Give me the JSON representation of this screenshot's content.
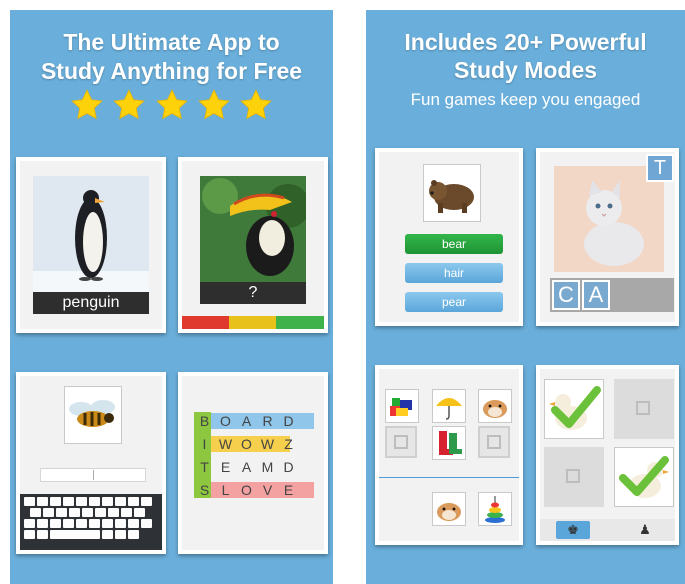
{
  "left_panel": {
    "headline_line1": "The Ultimate App to",
    "headline_line2": "Study Anything for Free",
    "stars": [
      "star-icon",
      "star-icon",
      "star-icon",
      "star-icon",
      "star-icon"
    ],
    "flashcard": {
      "word": "penguin",
      "image": "penguin-icon"
    },
    "guess_card": {
      "prompt": "?",
      "image": "hornbill-icon",
      "meter_colors": [
        "#e03a2f",
        "#e8c11a",
        "#3fb34a"
      ]
    },
    "typing_card": {
      "image": "bee-icon",
      "keyboard": "keyboard-icon"
    },
    "word_search": {
      "rows": [
        [
          "B",
          "O",
          "A",
          "R",
          "D"
        ],
        [
          "I",
          "W",
          "O",
          "W",
          "Z"
        ],
        [
          "T",
          "E",
          "A",
          "M",
          "D"
        ],
        [
          "S",
          "L",
          "O",
          "V",
          "E"
        ]
      ]
    }
  },
  "right_panel": {
    "headline_line1": "Includes 20+ Powerful",
    "headline_line2": "Study Modes",
    "subtitle": "Fun games keep you engaged",
    "multiple_choice": {
      "image": "bear-icon",
      "options": [
        "bear",
        "hair",
        "pear"
      ]
    },
    "spelling": {
      "image": "cat-icon",
      "hint_letter": "T",
      "letters": [
        "C",
        "A"
      ]
    },
    "matching": {
      "items": [
        "toy-icon",
        "umbrella-icon",
        "hamster-icon",
        "boots-icon",
        "hamster-icon",
        "stacking-toy-icon"
      ]
    },
    "memory": {
      "items": [
        "duck-check-icon",
        "duck-check-icon"
      ],
      "tab_icons": [
        "chess-king-icon",
        "chess-pawn-icon"
      ]
    }
  },
  "colors": {
    "background": "#6aafdb",
    "star": "#fdd20a",
    "correct": "#1e9434",
    "option": "#5aa6da"
  }
}
